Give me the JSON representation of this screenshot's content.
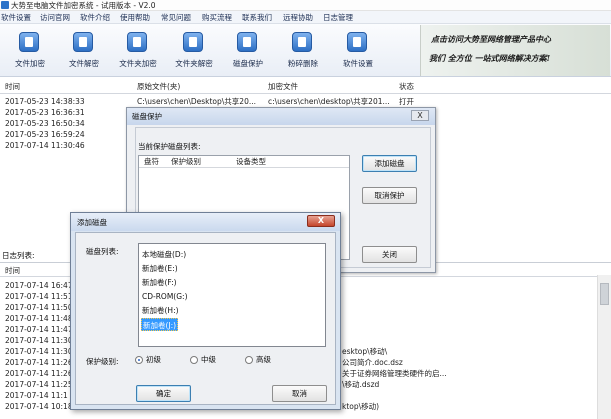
{
  "window": {
    "title": "大势至电脑文件加密系统 - 试用版本 - V2.0"
  },
  "menu": [
    "软件设置",
    "访问官网",
    "软件介绍",
    "使用帮助",
    "常见问题",
    "购买流程",
    "联系我们",
    "远程协助",
    "日志管理"
  ],
  "toolbar": {
    "buttons": [
      "文件加密",
      "文件解密",
      "文件夹加密",
      "文件夹解密",
      "磁盘保护",
      "粉碎删除",
      "软件设置"
    ],
    "banner_line1": "点击访问大势至网络管理产品中心",
    "banner_line2": "我们 全方位 一站式网络解决方案!"
  },
  "file_table": {
    "headers": [
      "时间",
      "原始文件(夹)",
      "加密文件",
      "状态"
    ],
    "rows": [
      [
        "2017-05-23 14:38:33",
        "C:\\users\\chen\\Desktop\\共享20...",
        "c:\\users\\chen\\desktop\\共享201...",
        "打开"
      ],
      [
        "2017-05-23 16:36:31",
        "",
        "",
        ""
      ],
      [
        "2017-05-23 16:50:34",
        "",
        "",
        ""
      ],
      [
        "2017-05-23 16:59:24",
        "",
        "",
        ""
      ],
      [
        "2017-07-14 11:30:46",
        "",
        "",
        ""
      ]
    ]
  },
  "log": {
    "label": "日志列表:",
    "header": "时间",
    "rows": [
      {
        "time": "2017-07-14 16:47",
        "detail": ""
      },
      {
        "time": "2017-07-14 11:51",
        "detail": ""
      },
      {
        "time": "2017-07-14 11:50",
        "detail": ""
      },
      {
        "time": "2017-07-14 11:48",
        "detail": ""
      },
      {
        "time": "2017-07-14 11:47",
        "detail": ""
      },
      {
        "time": "2017-07-14 11:30",
        "detail": ""
      },
      {
        "time": "2017-07-14 11:30",
        "detail": "esktop\\移动\\"
      },
      {
        "time": "2017-07-14 11:26",
        "detail": "公司简介.doc.dsz"
      },
      {
        "time": "2017-07-14 11:26",
        "detail": "关于证券网络管理类硬件的启..."
      },
      {
        "time": "2017-07-14 11:25",
        "detail": "\\移动.dszd"
      },
      {
        "time": "2017-07-14 11:1",
        "detail": ""
      },
      {
        "time": "2017-07-14 10:18",
        "detail": "ktop\\移动)"
      }
    ]
  },
  "protect_dialog": {
    "title": "磁盘保护",
    "list_label": "当前保护磁盘列表:",
    "columns": [
      "盘符",
      "保护级别",
      "设备类型"
    ],
    "add_button": "添加磁盘",
    "cancel_button": "取消保护",
    "close_button": "关闭",
    "close_x": "X"
  },
  "add_dialog": {
    "title": "添加磁盘",
    "close_x": "X",
    "list_label": "磁盘列表:",
    "disks": [
      "本地磁盘(D:)",
      "新加卷(E:)",
      "新加卷(F:)",
      "CD-ROM(G:)",
      "新加卷(H:)",
      "新加卷(J:)"
    ],
    "selected_index": 5,
    "level_label": "保护级别:",
    "levels": [
      "初级",
      "中级",
      "高级"
    ],
    "selected_level": 0,
    "ok_button": "确定",
    "cancel_button": "取消"
  }
}
